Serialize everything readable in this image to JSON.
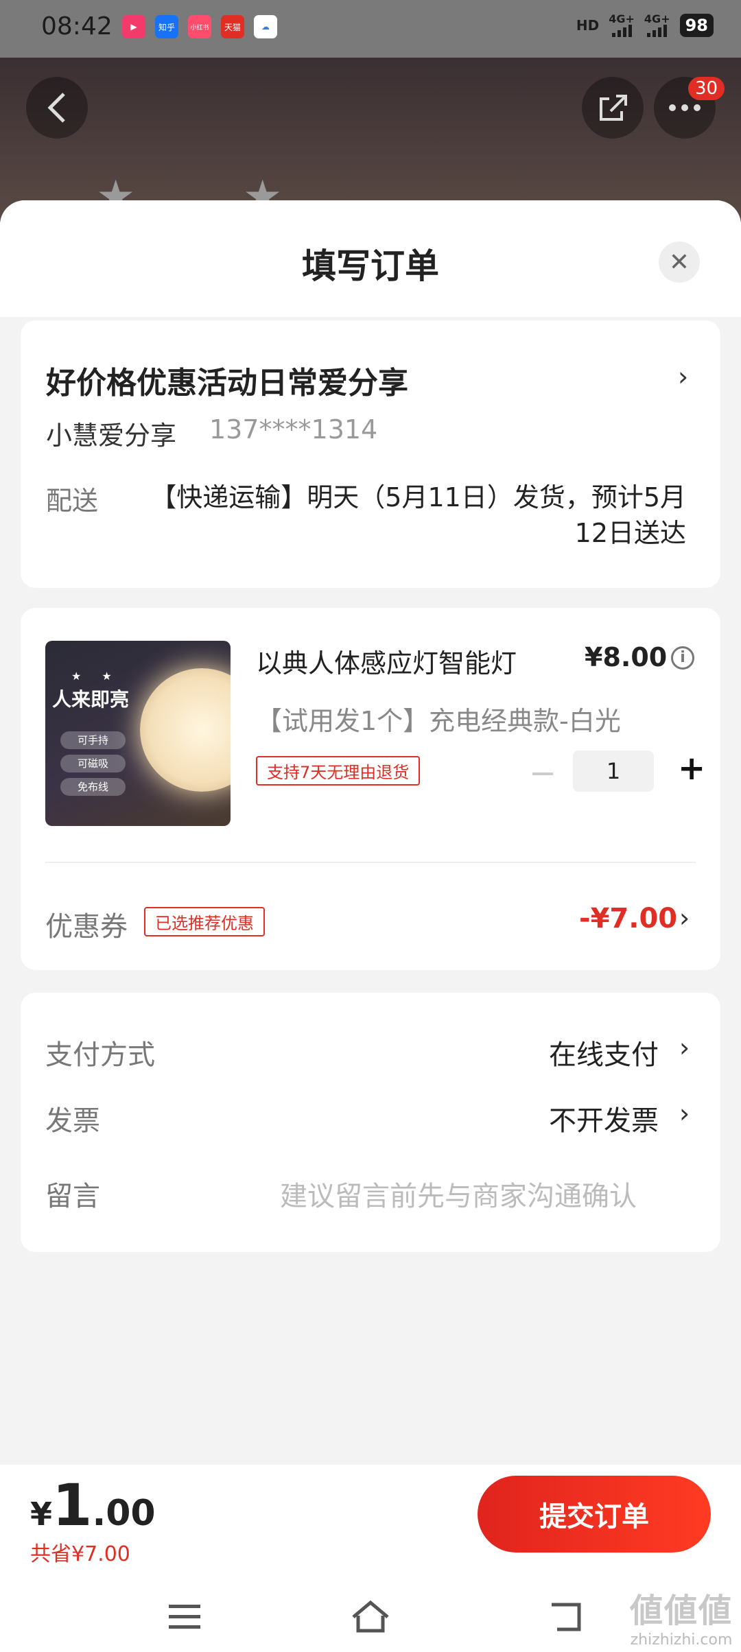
{
  "status_bar": {
    "time": "08:42",
    "apps": [
      {
        "name": "video-app-icon",
        "color": "#f23b6b",
        "label": "▶"
      },
      {
        "name": "zhihu-icon",
        "color": "#1772f6",
        "label": "知乎"
      },
      {
        "name": "xiaohongshu-icon",
        "color": "#ff4d6d",
        "label": "小红书"
      },
      {
        "name": "tmall-icon",
        "color": "#e02e24",
        "label": "天猫"
      },
      {
        "name": "cloud-app-icon",
        "color": "#ffffff",
        "label": "☁"
      }
    ],
    "hd": "HD",
    "sim1": "4G+",
    "sim2": "4G+",
    "battery": "98"
  },
  "top_bar": {
    "badge_count": "30"
  },
  "sheet": {
    "title": "填写订单",
    "close_label": "✕"
  },
  "address": {
    "name": "好价格优惠活动日常爱分享",
    "person": "小慧爱分享",
    "phone": "137****1314",
    "delivery_label": "配送",
    "delivery_text": "【快递运输】明天（5月11日）发货，预计5月12日送达"
  },
  "product": {
    "image_slogan": "人来即亮",
    "image_tags": [
      "可手持",
      "可磁吸",
      "免布线"
    ],
    "title": "以典人体感应灯智能灯",
    "price": "¥8.00",
    "spec": "【试用发1个】充电经典款-白光",
    "return_tag": "支持7天无理由退货",
    "quantity": "1"
  },
  "coupon": {
    "label": "优惠券",
    "tag": "已选推荐优惠",
    "value": "-¥7.00"
  },
  "payment": {
    "method_label": "支付方式",
    "method_value": "在线支付",
    "invoice_label": "发票",
    "invoice_value": "不开发票",
    "message_label": "留言",
    "message_placeholder": "建议留言前先与商家沟通确认"
  },
  "footer": {
    "currency": "¥",
    "total_int": "1",
    "total_dec": ".00",
    "saved": "共省¥7.00",
    "submit_label": "提交订单"
  },
  "watermark": {
    "mark": "値値値",
    "site": "zhizhizhi.com"
  }
}
